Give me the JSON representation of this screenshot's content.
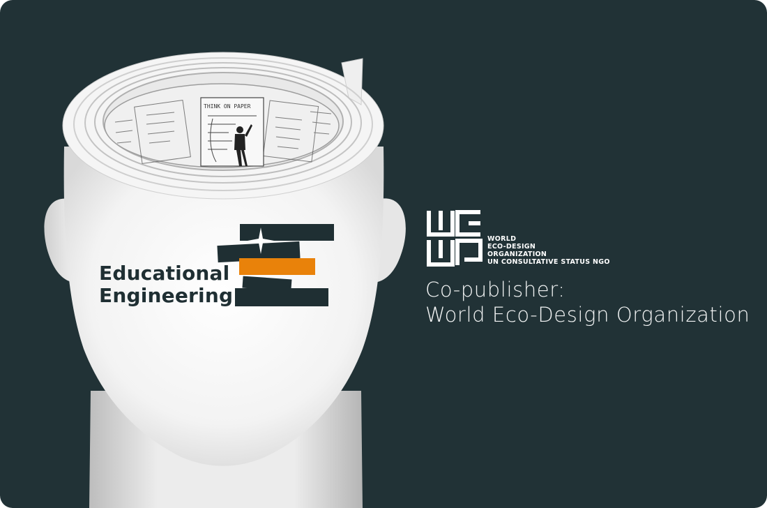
{
  "colors": {
    "background": "#213236",
    "head": "#f4f4f4",
    "brick_dark": "#1f2f33",
    "brick_accent": "#e9820a",
    "text_light": "#ffffff"
  },
  "logo": {
    "line1": "Educational",
    "line2": "Engineering"
  },
  "wedo": {
    "mark_icon": "wedo-monogram-logo",
    "lines": [
      "WORLD",
      "ECO-DESIGN",
      "ORGANIZATION",
      "UN CONSULTATIVE STATUS NGO"
    ]
  },
  "copublisher": {
    "label": "Co-publisher:",
    "name": "World Eco-Design Organization"
  },
  "illustration": {
    "paper_heading": "THINK ON PAPER"
  }
}
